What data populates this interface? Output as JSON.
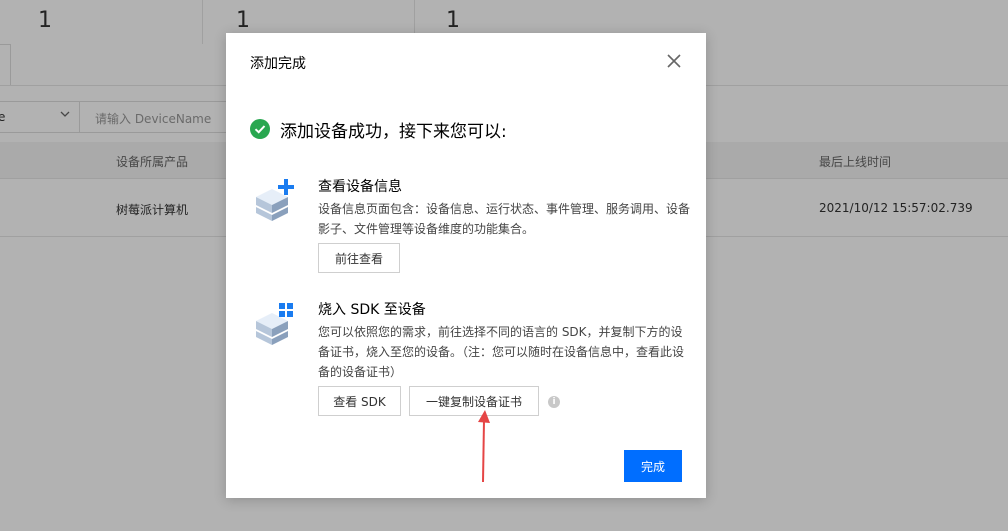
{
  "background": {
    "stats": [
      "1",
      "1",
      "1"
    ],
    "filter": {
      "select_value": "e",
      "input_placeholder": "请输入 DeviceName"
    },
    "table": {
      "headers": [
        "设备所属产品",
        "最后上线时间"
      ],
      "row": {
        "product": "树莓派计算机",
        "last_online": "2021/10/12 15:57:02.739"
      }
    }
  },
  "modal": {
    "title": "添加完成",
    "success_text": "添加设备成功，接下来您可以:",
    "view_section": {
      "title": "查看设备信息",
      "desc": "设备信息页面包含：设备信息、运行状态、事件管理、服务调用、设备影子、文件管理等设备维度的功能集合。",
      "button": "前往查看"
    },
    "sdk_section": {
      "title": "烧入 SDK 至设备",
      "desc": "您可以依照您的需求，前往选择不同的语言的 SDK，并复制下方的设备证书，烧入至您的设备。（注：您可以随时在设备信息中，查看此设备的设备证书）",
      "button_sdk": "查看 SDK",
      "button_copy": "一键复制设备证书"
    },
    "done_button": "完成"
  },
  "colors": {
    "primary": "#006eff",
    "success": "#29a750",
    "annotation": "#e54545"
  }
}
